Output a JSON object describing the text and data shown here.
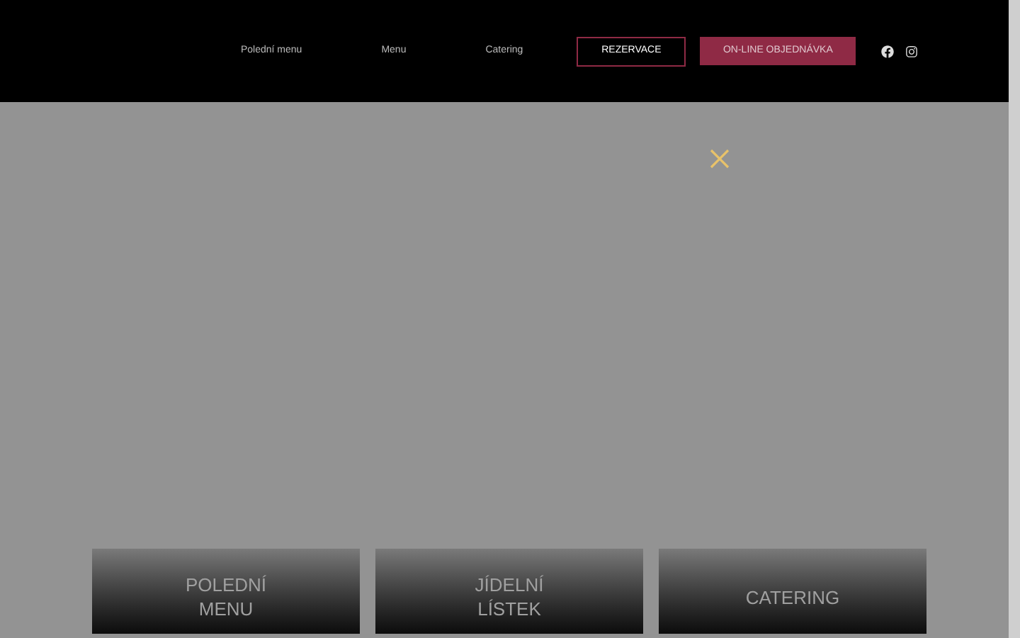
{
  "header": {
    "nav": [
      {
        "label": "Polední menu"
      },
      {
        "label": "Menu"
      },
      {
        "label": "Catering"
      }
    ],
    "buttons": [
      {
        "label": "REZERVACE",
        "kind": "outline"
      },
      {
        "label": "ON-LINE OBJEDNÁVKA",
        "kind": "filled"
      }
    ]
  },
  "cards": [
    {
      "label": "POLEDNÍ MENU"
    },
    {
      "label": "JÍDELNÍ LÍSTEK"
    },
    {
      "label": "CATERING"
    }
  ]
}
